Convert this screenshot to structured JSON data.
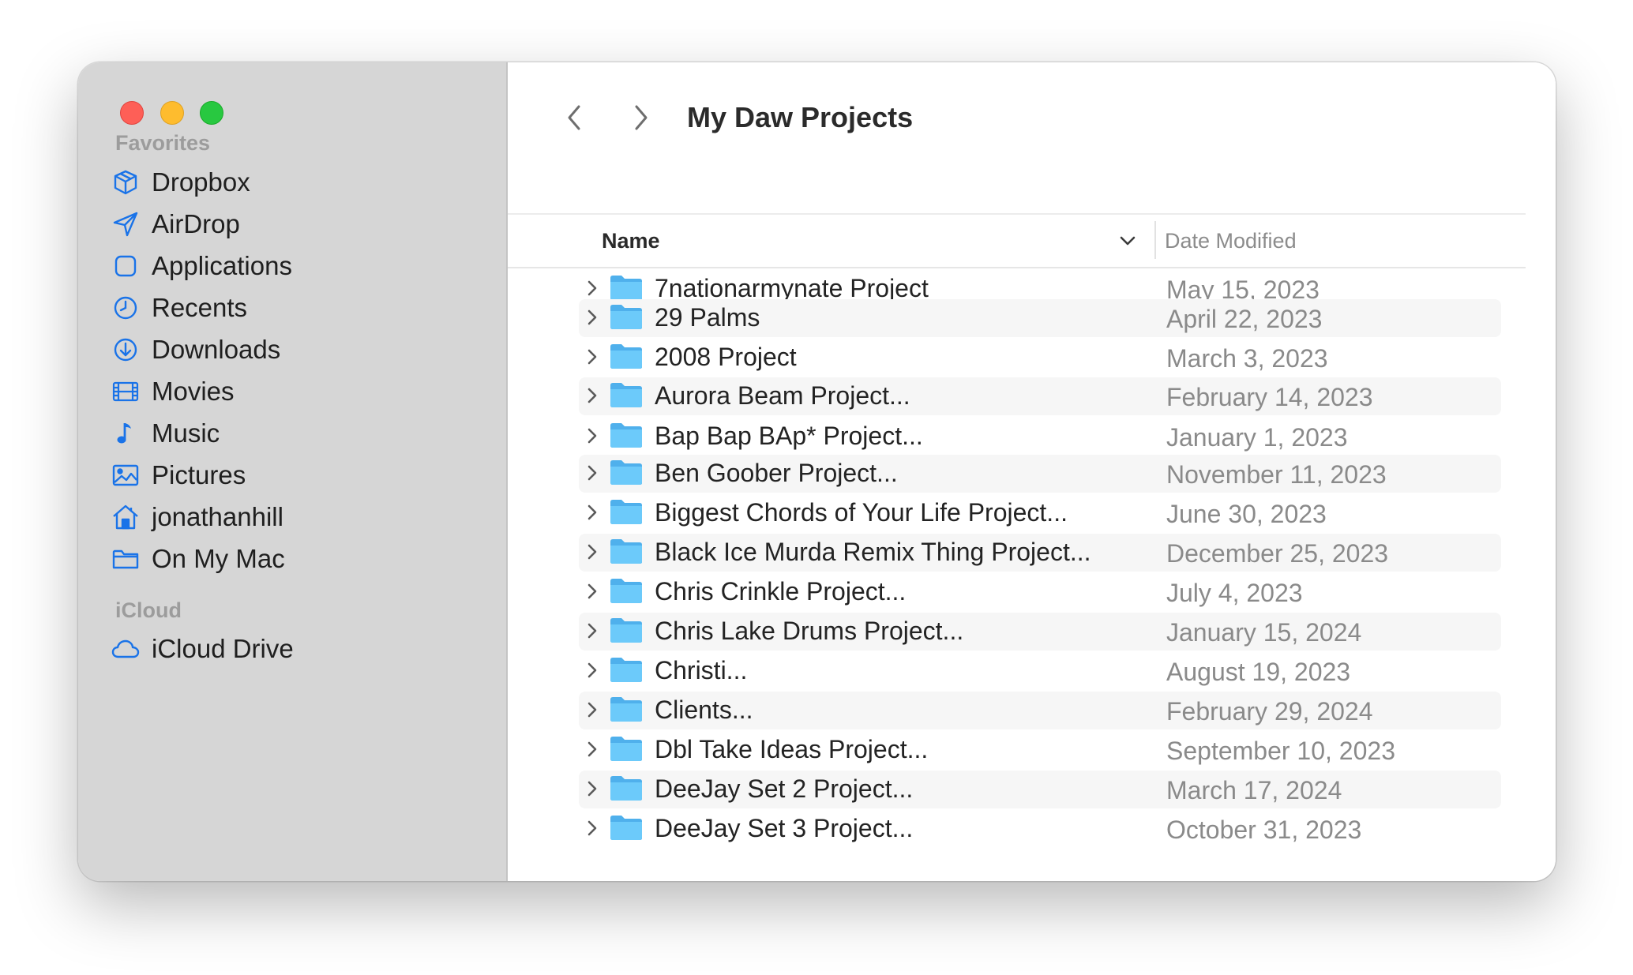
{
  "window": {
    "title": "My Daw Projects"
  },
  "colors": {
    "accent": "#1a73e8",
    "folder": "#62c2f5",
    "sidebar_bg": "#d6d6d6"
  },
  "sidebar": {
    "favorites_label": "Favorites",
    "icloud_label": "iCloud",
    "items": [
      {
        "label": "Dropbox",
        "icon": "dropbox-icon"
      },
      {
        "label": "AirDrop",
        "icon": "airdrop-icon"
      },
      {
        "label": "Applications",
        "icon": "applications-icon"
      },
      {
        "label": "Recents",
        "icon": "clock-icon"
      },
      {
        "label": "Downloads",
        "icon": "download-icon"
      },
      {
        "label": "Movies",
        "icon": "film-icon"
      },
      {
        "label": "Music",
        "icon": "music-note-icon"
      },
      {
        "label": "Pictures",
        "icon": "photo-icon"
      },
      {
        "label": "jonathanhill",
        "icon": "home-icon"
      },
      {
        "label": "On My Mac",
        "icon": "folder-icon"
      }
    ],
    "icloud_items": [
      {
        "label": "iCloud Drive",
        "icon": "cloud-icon"
      }
    ]
  },
  "columns": {
    "name": "Name",
    "date_modified": "Date Modified"
  },
  "rows": [
    {
      "name": "7nationarmynate Project",
      "date": "May 15, 2023"
    },
    {
      "name": "29 Palms",
      "date": "April 22, 2023"
    },
    {
      "name": "2008 Project",
      "date": "March 3, 2023"
    },
    {
      "name": "Aurora Beam Project...",
      "date": "February 14, 2023"
    },
    {
      "name": "Bap Bap BAp* Project...",
      "date": "January 1, 2023"
    },
    {
      "name": "Ben Goober Project...",
      "date": "November 11, 2023"
    },
    {
      "name": "Biggest Chords of Your Life Project...",
      "date": "June 30, 2023"
    },
    {
      "name": "Black Ice Murda Remix Thing Project...",
      "date": "December 25, 2023"
    },
    {
      "name": "Chris Crinkle Project...",
      "date": "July 4, 2023"
    },
    {
      "name": "Chris Lake Drums Project...",
      "date": "January 15, 2024"
    },
    {
      "name": "Christi...",
      "date": "August 19, 2023"
    },
    {
      "name": "Clients...",
      "date": "February 29, 2024"
    },
    {
      "name": "Dbl Take Ideas Project...",
      "date": "September 10, 2023"
    },
    {
      "name": "DeeJay Set 2 Project...",
      "date": "March 17, 2024"
    },
    {
      "name": "DeeJay Set 3 Project...",
      "date": "October 31, 2023"
    }
  ]
}
